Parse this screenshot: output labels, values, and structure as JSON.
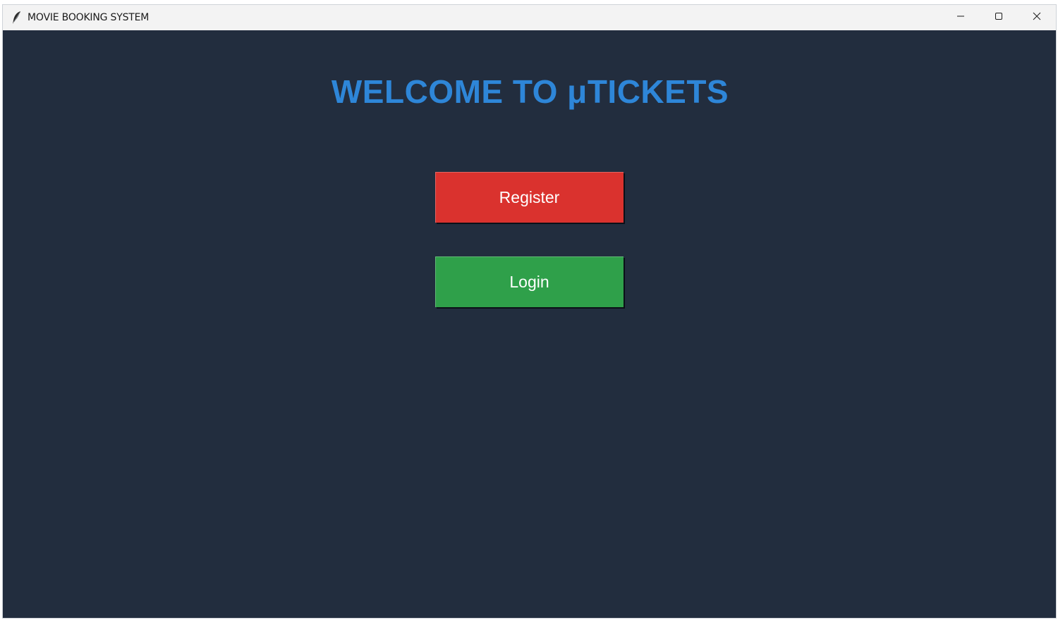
{
  "window": {
    "title": "MOVIE BOOKING SYSTEM",
    "app_icon": "feather-icon",
    "controls": {
      "minimize_icon": "minimize-icon",
      "maximize_icon": "maximize-icon",
      "close_icon": "close-icon"
    }
  },
  "main": {
    "heading": "WELCOME TO μTICKETS",
    "register_label": "Register",
    "login_label": "Login"
  },
  "colors": {
    "background": "#222d3e",
    "heading": "#2e86d8",
    "register_button": "#da322e",
    "login_button": "#2fa04a",
    "titlebar": "#f3f3f3"
  }
}
